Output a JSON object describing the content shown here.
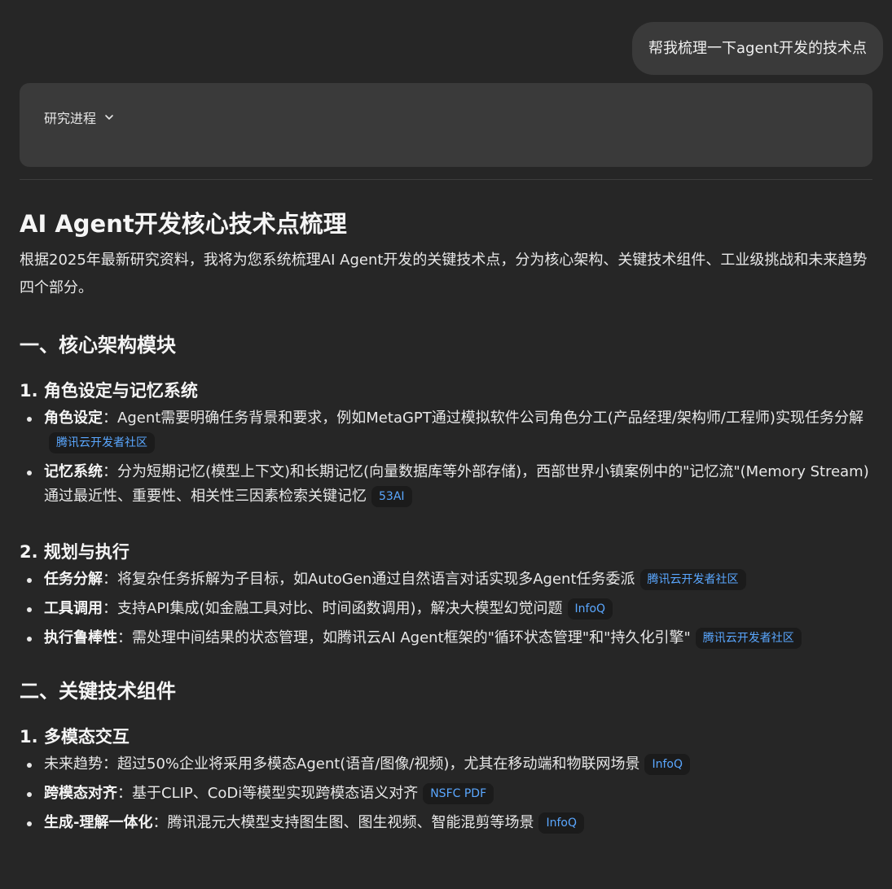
{
  "user_message": "帮我梳理一下agent开发的技术点",
  "progress": {
    "label": "研究进程",
    "icon": "chevron-down-icon"
  },
  "title": "AI Agent开发核心技术点梳理",
  "intro": "根据2025年最新研究资料，我将为您系统梳理AI Agent开发的关键技术点，分为核心架构、关键技术组件、工业级挑战和未来趋势四个部分。",
  "sections": [
    {
      "heading": "一、核心架构模块",
      "subsections": [
        {
          "heading": "1. 角色设定与记忆系统",
          "items": [
            {
              "term": "角色设定",
              "text": "：Agent需要明确任务背景和要求，例如MetaGPT通过模拟软件公司角色分工(产品经理/架构师/工程师)实现任务分解",
              "source": "腾讯云开发者社区"
            },
            {
              "term": "记忆系统",
              "text": "：分为短期记忆(模型上下文)和长期记忆(向量数据库等外部存储)，西部世界小镇案例中的\"记忆流\"(Memory Stream)通过最近性、重要性、相关性三因素检索关键记忆",
              "source": "53AI"
            }
          ]
        },
        {
          "heading": "2. 规划与执行",
          "items": [
            {
              "term": "任务分解",
              "text": "：将复杂任务拆解为子目标，如AutoGen通过自然语言对话实现多Agent任务委派",
              "source": "腾讯云开发者社区"
            },
            {
              "term": "工具调用",
              "text": "：支持API集成(如金融工具对比、时间函数调用)，解决大模型幻觉问题",
              "source": "InfoQ"
            },
            {
              "term": "执行鲁棒性",
              "text": "：需处理中间结果的状态管理，如腾讯云AI Agent框架的\"循环状态管理\"和\"持久化引擎\"",
              "source": "腾讯云开发者社区"
            }
          ]
        }
      ]
    },
    {
      "heading": "二、关键技术组件",
      "subsections": [
        {
          "heading": "1. 多模态交互",
          "items": [
            {
              "term": "",
              "text": "未来趋势：超过50%企业将采用多模态Agent(语音/图像/视频)，尤其在移动端和物联网场景",
              "source": "InfoQ"
            },
            {
              "term": "跨模态对齐",
              "text": "：基于CLIP、CoDi等模型实现跨模态语义对齐",
              "source": "NSFC PDF"
            },
            {
              "term": "生成-理解一体化",
              "text": "：腾讯混元大模型支持图生图、图生视频、智能混剪等场景",
              "source": "InfoQ"
            }
          ]
        }
      ]
    }
  ]
}
